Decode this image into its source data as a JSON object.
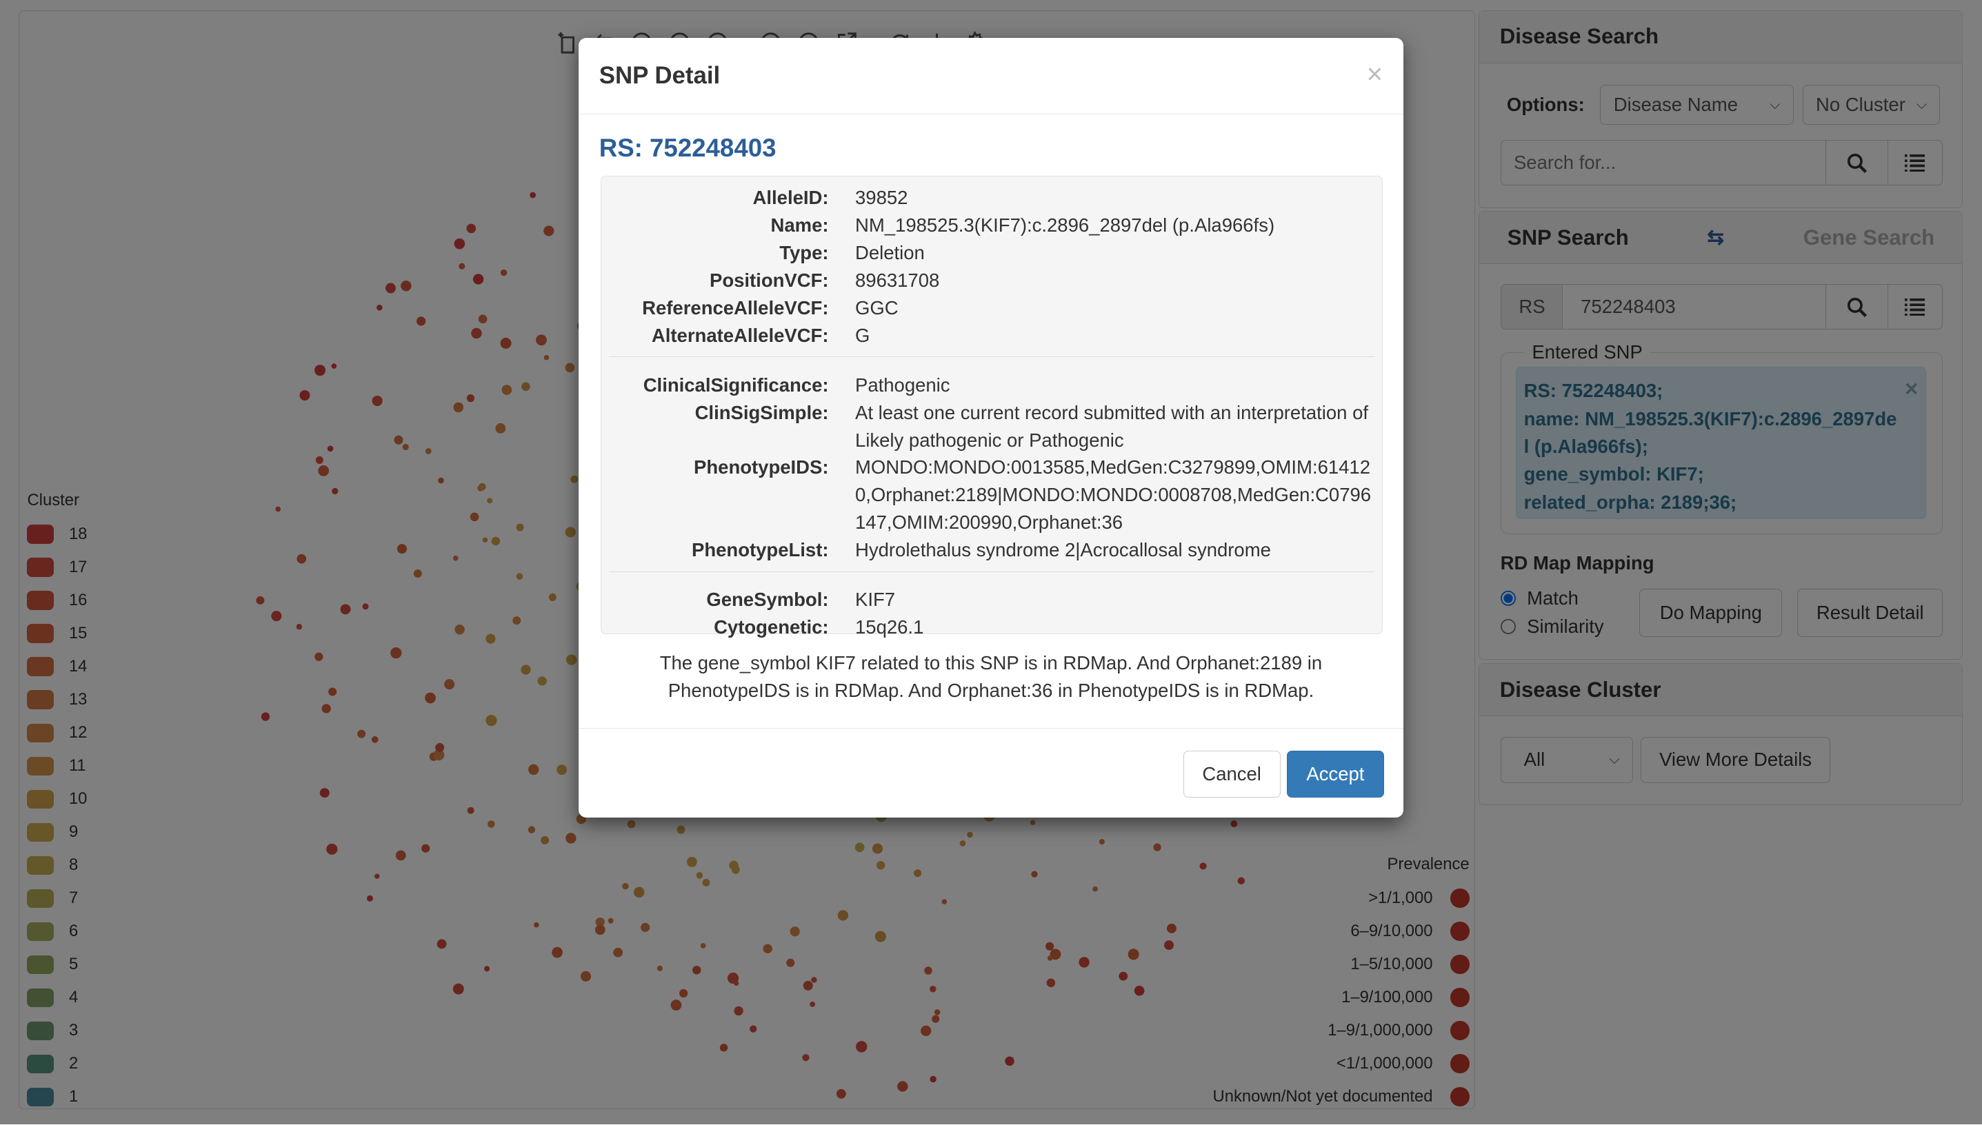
{
  "toolbar": {
    "icons": [
      "rect-select-icon",
      "lasso-select-icon",
      "circle-icon",
      "clear-icon",
      "globe-icon",
      "target-icon",
      "close-circle-icon",
      "export-icon",
      "refresh-icon",
      "download-icon",
      "settings-icon"
    ]
  },
  "cluster_legend": {
    "title": "Cluster",
    "items": [
      {
        "label": "18",
        "color": "#d1403f"
      },
      {
        "label": "17",
        "color": "#d24a3e"
      },
      {
        "label": "16",
        "color": "#d4563f"
      },
      {
        "label": "15",
        "color": "#d5623f"
      },
      {
        "label": "14",
        "color": "#d56e44"
      },
      {
        "label": "13",
        "color": "#d57b47"
      },
      {
        "label": "12",
        "color": "#d6894a"
      },
      {
        "label": "11",
        "color": "#d5964b"
      },
      {
        "label": "10",
        "color": "#d4a24c"
      },
      {
        "label": "9",
        "color": "#cfad4e"
      },
      {
        "label": "8",
        "color": "#c6b050"
      },
      {
        "label": "7",
        "color": "#b9b158"
      },
      {
        "label": "6",
        "color": "#a9ae5e"
      },
      {
        "label": "5",
        "color": "#96a862"
      },
      {
        "label": "4",
        "color": "#84a068"
      },
      {
        "label": "3",
        "color": "#6f9a74"
      },
      {
        "label": "2",
        "color": "#5b9581"
      },
      {
        "label": "1",
        "color": "#4a8c9e"
      }
    ]
  },
  "prevalence_legend": {
    "title": "Prevalence",
    "color": "#c0392b",
    "items": [
      ">1/1,000",
      "6–9/10,000",
      "1–5/10,000",
      "1–9/100,000",
      "1–9/1,000,000",
      "<1/1,000,000",
      "Unknown/Not yet documented"
    ]
  },
  "disease_search": {
    "title": "Disease Search",
    "options_label": "Options:",
    "option_select": "Disease Name",
    "cluster_select": "No Cluster",
    "search_placeholder": "Search for..."
  },
  "snp_search": {
    "title": "SNP Search",
    "alt_title": "Gene Search",
    "rs_addon": "RS",
    "rs_value": "752248403",
    "entered_legend": "Entered SNP",
    "entered": [
      "RS: 752248403;",
      "name: NM_198525.3(KIF7):c.2896_2897del (p.Ala966fs);",
      "gene_symbol: KIF7;",
      "related_orpha: 2189;36;"
    ],
    "mapping_title": "RD Map Mapping",
    "radio_match": "Match",
    "radio_similarity": "Similarity",
    "selected_radio": "Match",
    "do_mapping": "Do Mapping",
    "result_detail": "Result Detail"
  },
  "disease_cluster": {
    "title": "Disease Cluster",
    "select": "All",
    "view_more": "View More Details"
  },
  "modal": {
    "title": "SNP Detail",
    "close": "×",
    "rs_title": "RS: 752248403",
    "group1": [
      {
        "k": "AlleleID:",
        "v": "39852"
      },
      {
        "k": "Name:",
        "v": "NM_198525.3(KIF7):c.2896_2897del (p.Ala966fs)"
      },
      {
        "k": "Type:",
        "v": "Deletion"
      },
      {
        "k": "PositionVCF:",
        "v": "89631708"
      },
      {
        "k": "ReferenceAlleleVCF:",
        "v": "GGC"
      },
      {
        "k": "AlternateAlleleVCF:",
        "v": "G"
      }
    ],
    "group2": [
      {
        "k": "ClinicalSignificance:",
        "v": "Pathogenic"
      },
      {
        "k": "ClinSigSimple:",
        "v": "At least one current record submitted with an interpretation of Likely pathogenic or Pathogenic"
      },
      {
        "k": "PhenotypeIDS:",
        "v": "MONDO:MONDO:0013585,MedGen:C3279899,OMIM:614120,Orphanet:2189|MONDO:MONDO:0008708,MedGen:C0796147,OMIM:200990,Orphanet:36"
      },
      {
        "k": "PhenotypeList:",
        "v": "Hydrolethalus syndrome 2|Acrocallosal syndrome"
      }
    ],
    "group3": [
      {
        "k": "GeneSymbol:",
        "v": "KIF7"
      },
      {
        "k": "Cytogenetic:",
        "v": "15q26.1"
      }
    ],
    "note": "The gene_symbol KIF7 related to this SNP is in RDMap. And Orphanet:2189 in PhenotypeIDS is in RDMap. And Orphanet:36 in PhenotypeIDS is in RDMap.",
    "cancel": "Cancel",
    "accept": "Accept",
    "accent": "#337ab7"
  }
}
